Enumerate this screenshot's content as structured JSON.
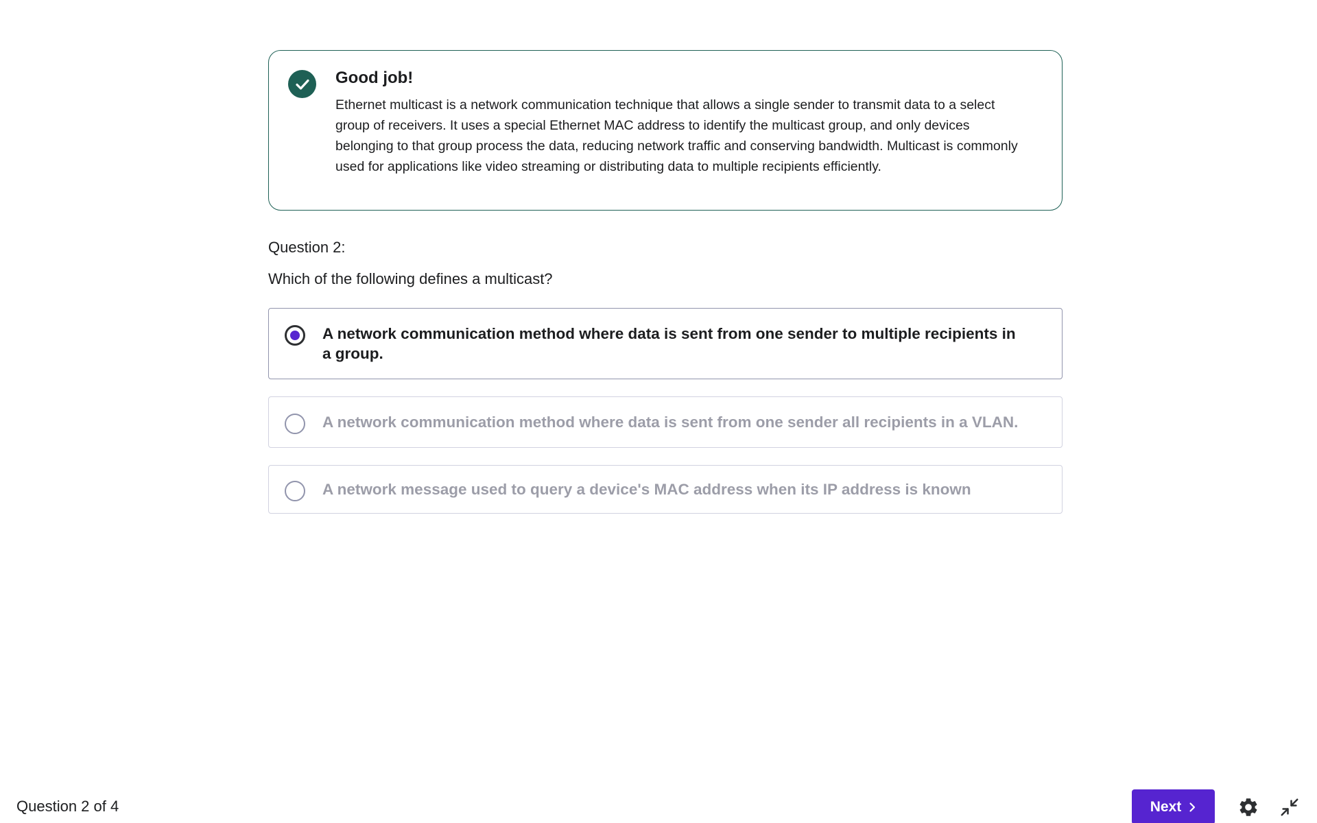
{
  "feedback": {
    "title": "Good job!",
    "body": "Ethernet multicast is a network communication technique that allows a single sender to transmit data to a select group of receivers. It uses a special Ethernet MAC address to identify the multicast group, and only devices belonging to that group process the data, reducing network traffic and conserving bandwidth. Multicast is commonly used for applications like video streaming or distributing data to multiple recipients efficiently.",
    "icon": "check-icon",
    "accent_color": "#1e6055"
  },
  "question": {
    "label": "Question 2:",
    "text": "Which of the following defines a multicast?",
    "options": [
      {
        "text": "A network communication method where data is sent from one sender to multiple recipients in a group.",
        "selected": true
      },
      {
        "text": "A network communication method where data is sent from one sender all recipients in a VLAN.",
        "selected": false
      },
      {
        "text": "A network message used to query a device's MAC address when its IP address is known",
        "selected": false
      }
    ]
  },
  "footer": {
    "progress": "Question 2 of 4",
    "next_label": "Next",
    "next_icon": "chevron-right-icon",
    "settings_icon": "gear-icon",
    "exit_fullscreen_icon": "collapse-icon",
    "button_color": "#5624d0"
  }
}
